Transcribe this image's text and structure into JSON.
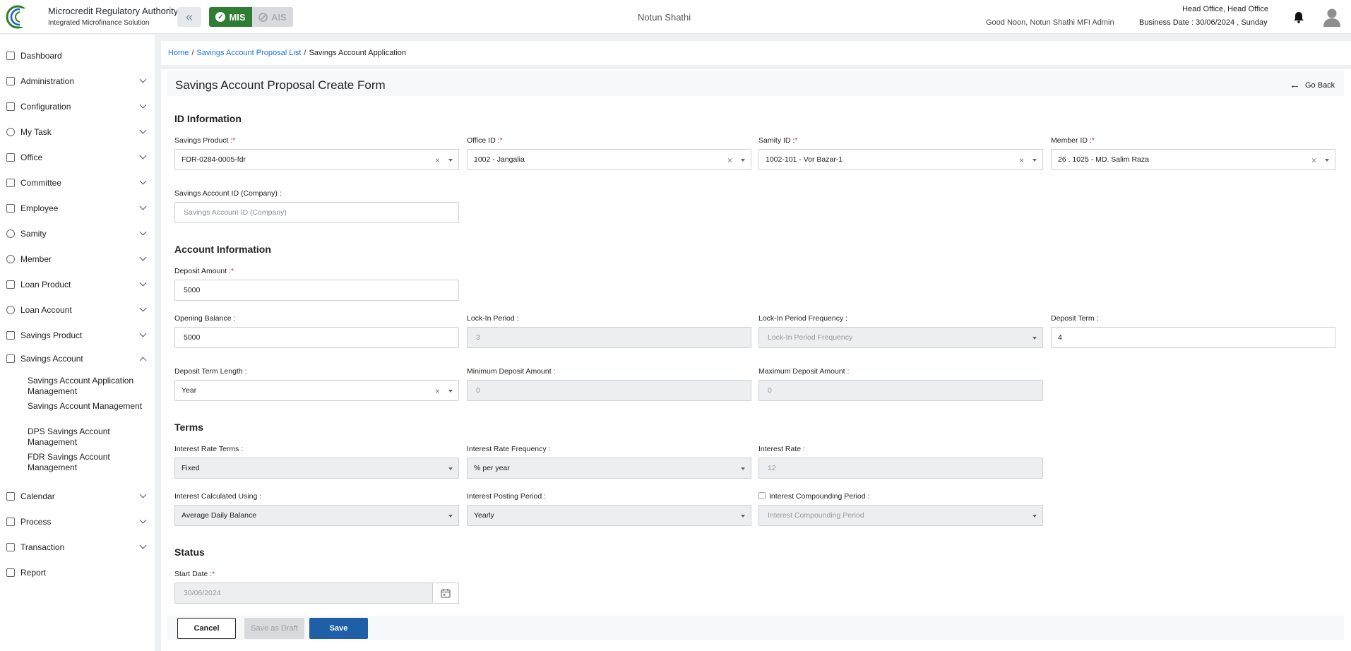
{
  "header": {
    "brand_title": "Microcredit Regulatory Authority",
    "brand_subtitle": "Integrated Microfinance Solution",
    "logo_text": "Microcredit Regulatory Authority",
    "mode_mis": "MIS",
    "mode_ais": "AIS",
    "org_name": "Notun Shathi",
    "greeting": "Good Noon, Notun Shathi MFI Admin",
    "office": "Head Office, Head Office",
    "business_date": "Business Date : 30/06/2024 , Sunday"
  },
  "sidebar": {
    "items": [
      {
        "label": "Dashboard"
      },
      {
        "label": "Administration"
      },
      {
        "label": "Configuration"
      },
      {
        "label": "My Task"
      },
      {
        "label": "Office"
      },
      {
        "label": "Committee"
      },
      {
        "label": "Employee"
      },
      {
        "label": "Samity"
      },
      {
        "label": "Member"
      },
      {
        "label": "Loan Product"
      },
      {
        "label": "Loan Account"
      },
      {
        "label": "Savings Product"
      },
      {
        "label": "Savings Account"
      },
      {
        "label": "Calendar"
      },
      {
        "label": "Process"
      },
      {
        "label": "Transaction"
      },
      {
        "label": "Report"
      }
    ],
    "sub_items": [
      {
        "label": "Savings Account Application Management"
      },
      {
        "label": "Savings Account Management"
      },
      {
        "label": "DPS Savings Account Management"
      },
      {
        "label": "FDR Savings Account Management"
      }
    ]
  },
  "breadcrumb": {
    "home": "Home",
    "list": "Savings Account Proposal List",
    "current": "Savings Account Application",
    "sep": "/"
  },
  "form": {
    "title": "Savings Account Proposal Create Form",
    "go_back": "Go Back",
    "required_mark": "*",
    "sections": {
      "id_info": "ID Information",
      "account_info": "Account Information",
      "terms": "Terms",
      "status": "Status"
    },
    "fields": {
      "savings_product": {
        "label": "Savings Product :",
        "value": "FDR-0284-0005-fdr"
      },
      "office_id": {
        "label": "Office ID :",
        "value": "1002 - Jangalia"
      },
      "samity_id": {
        "label": "Samity ID :",
        "value": "1002-101 - Vor Bazar-1"
      },
      "member_id": {
        "label": "Member ID :",
        "value": "26 . 1025 - MD. Salim Raza"
      },
      "savings_account_id": {
        "label": "Savings Account ID (Company) :",
        "placeholder": "Savings Account ID (Company)"
      },
      "deposit_amount": {
        "label": "Deposit Amount :",
        "value": "5000"
      },
      "opening_balance": {
        "label": "Opening Balance :",
        "value": "5000"
      },
      "lock_in_period": {
        "label": "Lock-In Period :",
        "value": "3"
      },
      "lock_in_freq": {
        "label": "Lock-In Period Frequency :",
        "placeholder": "Lock-In Period Frequency"
      },
      "deposit_term": {
        "label": "Deposit Term :",
        "value": "4"
      },
      "deposit_term_length": {
        "label": "Deposit Term Length :",
        "value": "Year"
      },
      "min_deposit": {
        "label": "Minimum Deposit Amount :",
        "value": "0"
      },
      "max_deposit": {
        "label": "Maximum Deposit Amount :",
        "value": "0"
      },
      "interest_rate_terms": {
        "label": "Interest Rate Terms :",
        "value": "Fixed"
      },
      "interest_rate_freq": {
        "label": "Interest Rate Frequency :",
        "value": "% per year"
      },
      "interest_rate": {
        "label": "Interest Rate :",
        "value": "12"
      },
      "interest_calc": {
        "label": "Interest Calculated Using :",
        "value": "Average Daily Balance"
      },
      "interest_posting": {
        "label": "Interest Posting Period :",
        "value": "Yearly"
      },
      "interest_compounding": {
        "label": "Interest Compounding Period :",
        "placeholder": "Interest Compounding Period"
      },
      "start_date": {
        "label": "Start Date :",
        "value": "30/06/2024"
      }
    },
    "buttons": {
      "cancel": "Cancel",
      "draft": "Save as Draft",
      "save": "Save"
    }
  }
}
